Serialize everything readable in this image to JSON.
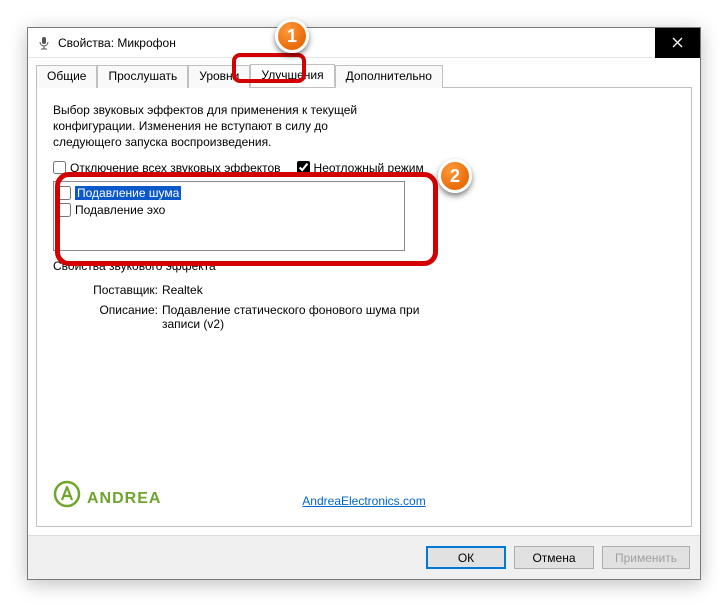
{
  "titlebar": {
    "title": "Свойства: Микрофон"
  },
  "tabs": {
    "t0": "Общие",
    "t1": "Прослушать",
    "t2": "Уровни",
    "t3": "Улучшения",
    "t4": "Дополнительно"
  },
  "desc": "Выбор звуковых эффектов для применения к текущей конфигурации. Изменения не вступают в силу до следующего запуска воспроизведения.",
  "checks": {
    "disable_all": "Отключение всех звуковых эффектов",
    "urgent": "Неотложный режим"
  },
  "effects": {
    "noise": "Подавление шума",
    "echo": "Подавление эхо"
  },
  "group_title": "Свойства звукового эффекта",
  "kv": {
    "vendor_k": "Поставщик:",
    "vendor_v": "Realtek",
    "desc_k": "Описание:",
    "desc_v": "Подавление статического фонового шума при записи (v2)"
  },
  "logo_text": "ANDREA",
  "link": "AndreaElectronics.com",
  "buttons": {
    "ok": "ОК",
    "cancel": "Отмена",
    "apply": "Применить"
  },
  "callouts": {
    "c1": "1",
    "c2": "2"
  }
}
